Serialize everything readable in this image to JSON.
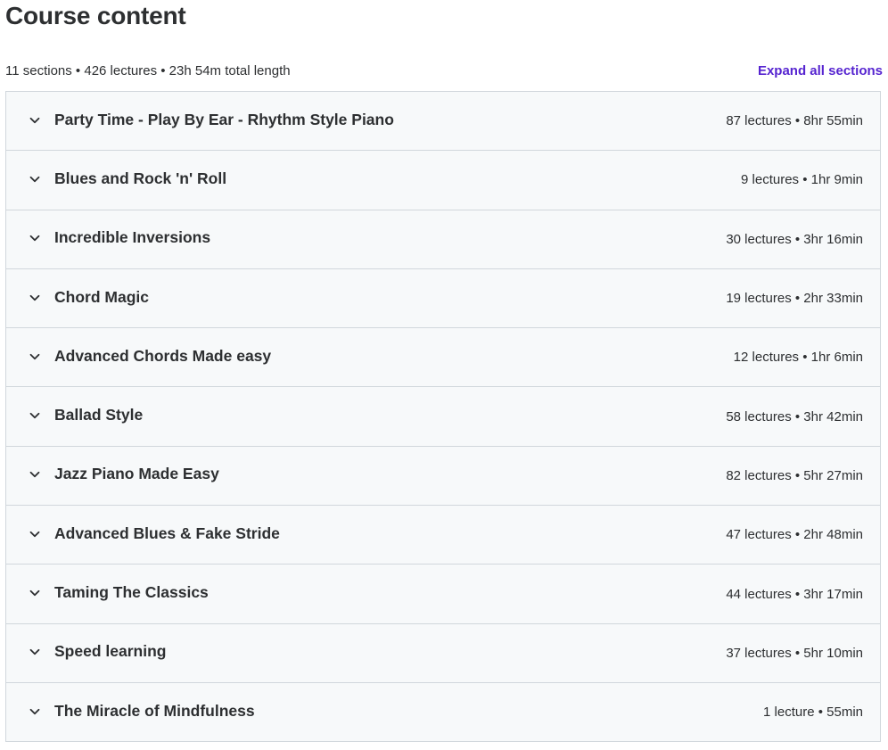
{
  "heading": "Course content",
  "summary": "11 sections • 426 lectures • 23h 54m total length",
  "expand_all": "Expand all sections",
  "sections": [
    {
      "title": "Party Time - Play By Ear - Rhythm Style Piano",
      "meta": "87 lectures • 8hr 55min"
    },
    {
      "title": "Blues and Rock 'n' Roll",
      "meta": "9 lectures • 1hr 9min"
    },
    {
      "title": "Incredible Inversions",
      "meta": "30 lectures • 3hr 16min"
    },
    {
      "title": "Chord Magic",
      "meta": "19 lectures • 2hr 33min"
    },
    {
      "title": "Advanced Chords Made easy",
      "meta": "12 lectures • 1hr 6min"
    },
    {
      "title": "Ballad Style",
      "meta": "58 lectures • 3hr 42min"
    },
    {
      "title": "Jazz Piano Made Easy",
      "meta": "82 lectures • 5hr 27min"
    },
    {
      "title": "Advanced Blues & Fake Stride",
      "meta": "47 lectures • 2hr 48min"
    },
    {
      "title": "Taming The Classics",
      "meta": "44 lectures • 3hr 17min"
    },
    {
      "title": "Speed learning",
      "meta": "37 lectures • 5hr 10min"
    },
    {
      "title": "The Miracle of Mindfulness",
      "meta": "1 lecture • 55min"
    }
  ],
  "colors": {
    "accent": "#5624d0",
    "text": "#2d2f31",
    "section_bg": "#f7f9fa",
    "border": "#d1d7dc"
  },
  "icons": {
    "section_toggle": "chevron-down-icon"
  }
}
